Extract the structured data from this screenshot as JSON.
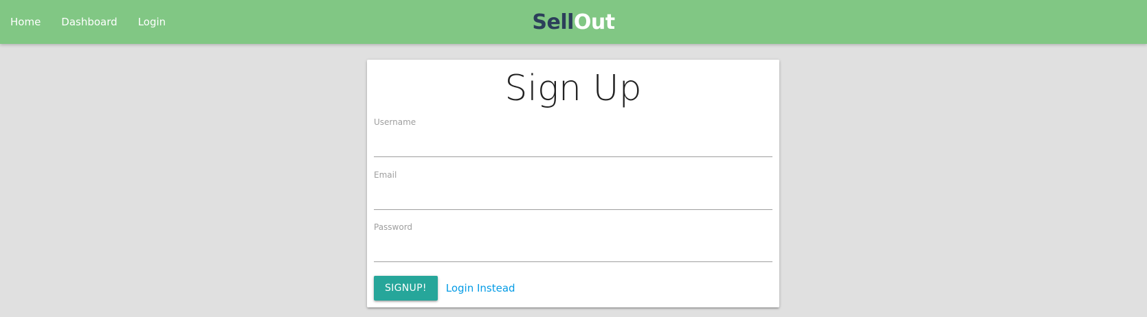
{
  "nav": {
    "links": [
      "Home",
      "Dashboard",
      "Login"
    ],
    "brand_part1": "Sell",
    "brand_part2": "Out"
  },
  "form": {
    "title": "Sign Up",
    "fields": [
      {
        "label": "Username",
        "value": ""
      },
      {
        "label": "Email",
        "value": ""
      },
      {
        "label": "Password",
        "value": ""
      }
    ],
    "submit_label": "SIGNUP!",
    "alt_link_label": "Login Instead"
  },
  "colors": {
    "navbar": "#81c784",
    "brand_dark": "#2c3e5a",
    "button": "#26a69a",
    "link": "#039be5",
    "page_bg": "#e0e0e0"
  }
}
